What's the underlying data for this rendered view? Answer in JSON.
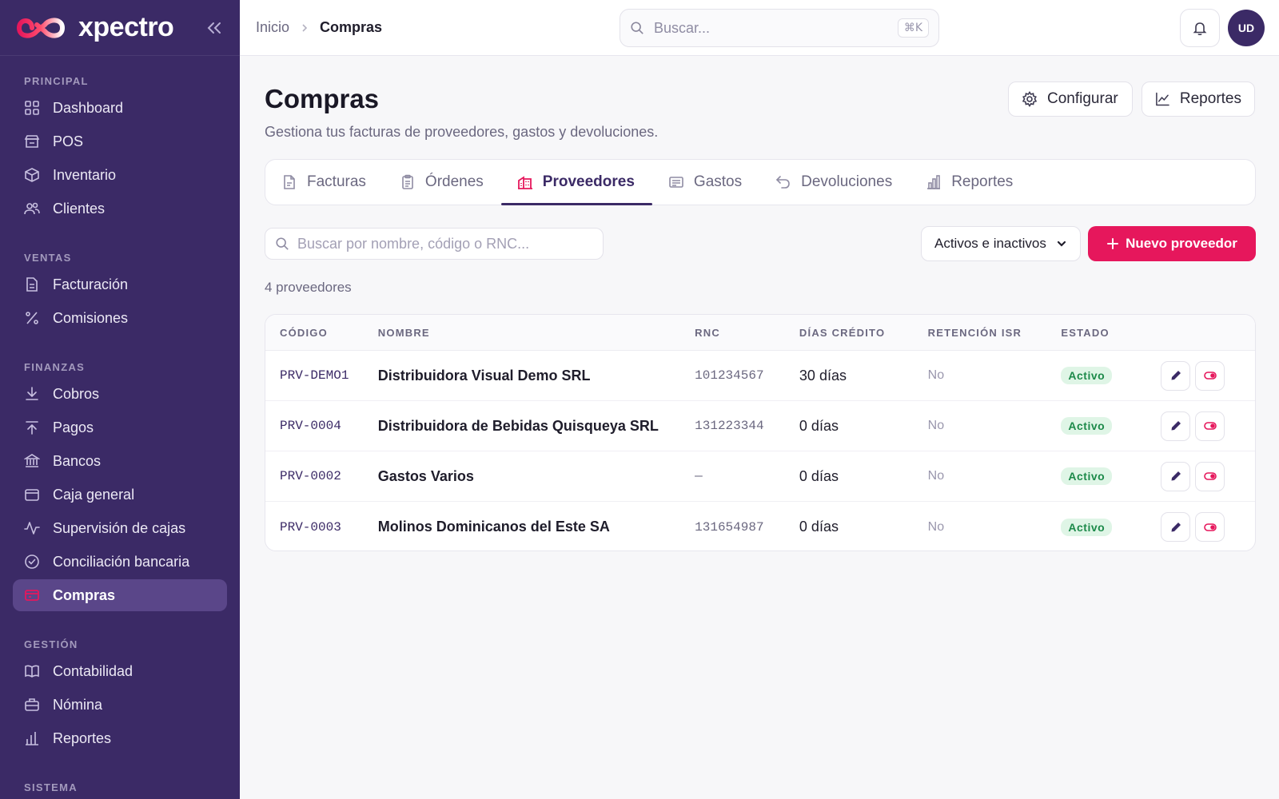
{
  "brand": {
    "name": "xpectro"
  },
  "sidebar": {
    "sections": [
      {
        "label": "PRINCIPAL",
        "items": [
          {
            "label": "Dashboard",
            "icon": "grid-icon"
          },
          {
            "label": "POS",
            "icon": "store-icon"
          },
          {
            "label": "Inventario",
            "icon": "box-icon"
          },
          {
            "label": "Clientes",
            "icon": "users-icon"
          }
        ]
      },
      {
        "label": "VENTAS",
        "items": [
          {
            "label": "Facturación",
            "icon": "invoice-icon"
          },
          {
            "label": "Comisiones",
            "icon": "percent-icon"
          }
        ]
      },
      {
        "label": "FINANZAS",
        "items": [
          {
            "label": "Cobros",
            "icon": "arrow-down-icon"
          },
          {
            "label": "Pagos",
            "icon": "arrow-up-icon"
          },
          {
            "label": "Bancos",
            "icon": "bank-icon"
          },
          {
            "label": "Caja general",
            "icon": "cash-box-icon"
          },
          {
            "label": "Supervisión de cajas",
            "icon": "activity-icon"
          },
          {
            "label": "Conciliación bancaria",
            "icon": "check-circle-icon"
          },
          {
            "label": "Compras",
            "icon": "cart-icon",
            "active": true
          }
        ]
      },
      {
        "label": "GESTIÓN",
        "items": [
          {
            "label": "Contabilidad",
            "icon": "book-icon"
          },
          {
            "label": "Nómina",
            "icon": "briefcase-icon"
          },
          {
            "label": "Reportes",
            "icon": "bar-chart-icon"
          }
        ]
      },
      {
        "label": "SISTEMA",
        "items": []
      }
    ]
  },
  "topbar": {
    "breadcrumb": {
      "home": "Inicio",
      "current": "Compras"
    },
    "search_placeholder": "Buscar...",
    "shortcut": "⌘K",
    "avatar_initials": "UD"
  },
  "page": {
    "title": "Compras",
    "subtitle": "Gestiona tus facturas de proveedores, gastos y devoluciones.",
    "config_label": "Configurar",
    "reports_label": "Reportes"
  },
  "tabs": [
    {
      "label": "Facturas",
      "icon": "file-icon"
    },
    {
      "label": "Órdenes",
      "icon": "clipboard-icon"
    },
    {
      "label": "Proveedores",
      "icon": "building-icon",
      "active": true
    },
    {
      "label": "Gastos",
      "icon": "receipt-icon"
    },
    {
      "label": "Devoluciones",
      "icon": "undo-icon"
    },
    {
      "label": "Reportes",
      "icon": "bar-chart-icon"
    }
  ],
  "filters": {
    "search_placeholder": "Buscar por nombre, código o RNC...",
    "status_value": "Activos e inactivos",
    "new_label": "Nuevo proveedor"
  },
  "count_label": "4 proveedores",
  "table": {
    "headers": {
      "code": "CÓDIGO",
      "name": "NOMBRE",
      "rnc": "RNC",
      "days": "DÍAS CRÉDITO",
      "isr": "RETENCIÓN ISR",
      "state": "ESTADO"
    },
    "rows": [
      {
        "code": "PRV-DEMO1",
        "name": "Distribuidora Visual Demo SRL",
        "rnc": "101234567",
        "days": "30 días",
        "isr": "No",
        "state": "Activo"
      },
      {
        "code": "PRV-0004",
        "name": "Distribuidora de Bebidas Quisqueya SRL",
        "rnc": "131223344",
        "days": "0 días",
        "isr": "No",
        "state": "Activo"
      },
      {
        "code": "PRV-0002",
        "name": "Gastos Varios",
        "rnc": "—",
        "days": "0 días",
        "isr": "No",
        "state": "Activo"
      },
      {
        "code": "PRV-0003",
        "name": "Molinos Dominicanos del Este SA",
        "rnc": "131654987",
        "days": "0 días",
        "isr": "No",
        "state": "Activo"
      }
    ]
  },
  "colors": {
    "sidebar": "#3b2a66",
    "accent": "#e6175c",
    "active_badge_bg": "#dff5e6",
    "active_badge_text": "#1d8a4a"
  }
}
